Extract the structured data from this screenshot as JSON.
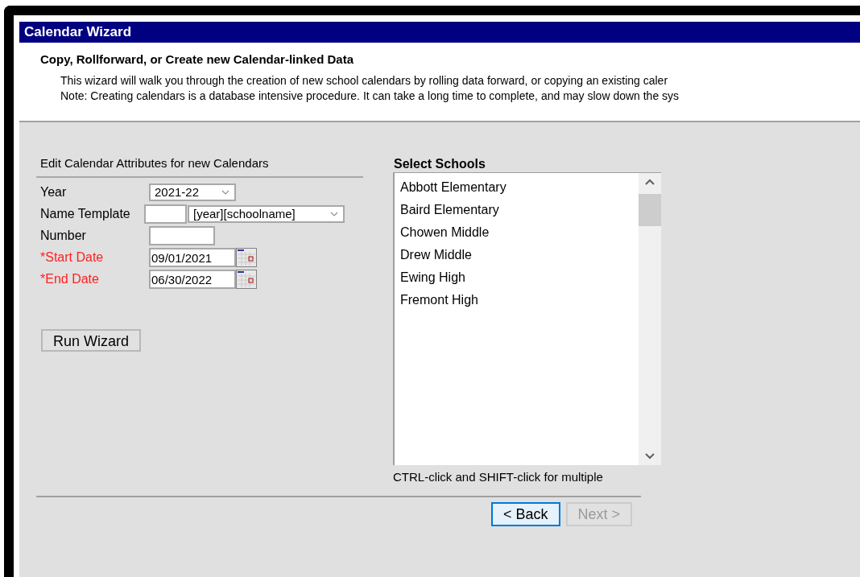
{
  "window": {
    "title": "Calendar Wizard"
  },
  "header": {
    "heading": "Copy, Rollforward, or Create new Calendar-linked Data",
    "lines": [
      "This wizard will walk you through the creation of new school calendars by rolling data forward, or copying an existing caler",
      "Note: Creating calendars is a database intensive procedure. It can take a long time to complete, and may slow down the sys"
    ]
  },
  "attributes": {
    "heading": "Edit Calendar Attributes for new Calendars",
    "fields": [
      {
        "kind": "select",
        "label": "Year",
        "required": false,
        "value": "2021-22"
      },
      {
        "kind": "template",
        "label": "Name Template",
        "required": false,
        "value": "[year][schoolname]"
      },
      {
        "kind": "text",
        "label": "Number",
        "required": false
      },
      {
        "kind": "date",
        "label": "*Start Date",
        "required": true,
        "value": "09/01/2021"
      },
      {
        "kind": "date",
        "label": "*End Date",
        "required": true,
        "value": "06/30/2022"
      }
    ],
    "run_button": "Run Wizard"
  },
  "schools": {
    "heading": "Select Schools",
    "items": [
      {
        "label": "Abbott Elementary",
        "selected": false
      },
      {
        "label": "Baird Elementary",
        "selected": false
      },
      {
        "label": "Chowen Middle",
        "selected": false
      },
      {
        "label": "Drew Middle",
        "selected": false
      },
      {
        "label": "Ewing High",
        "selected": false
      },
      {
        "label": "Fremont High",
        "selected": false
      }
    ],
    "hint": "CTRL-click and SHIFT-click for multiple"
  },
  "buttons": [
    {
      "label": "< Back",
      "disabled": false,
      "focused": true
    },
    {
      "label": "Next >",
      "disabled": true,
      "focused": false
    }
  ]
}
